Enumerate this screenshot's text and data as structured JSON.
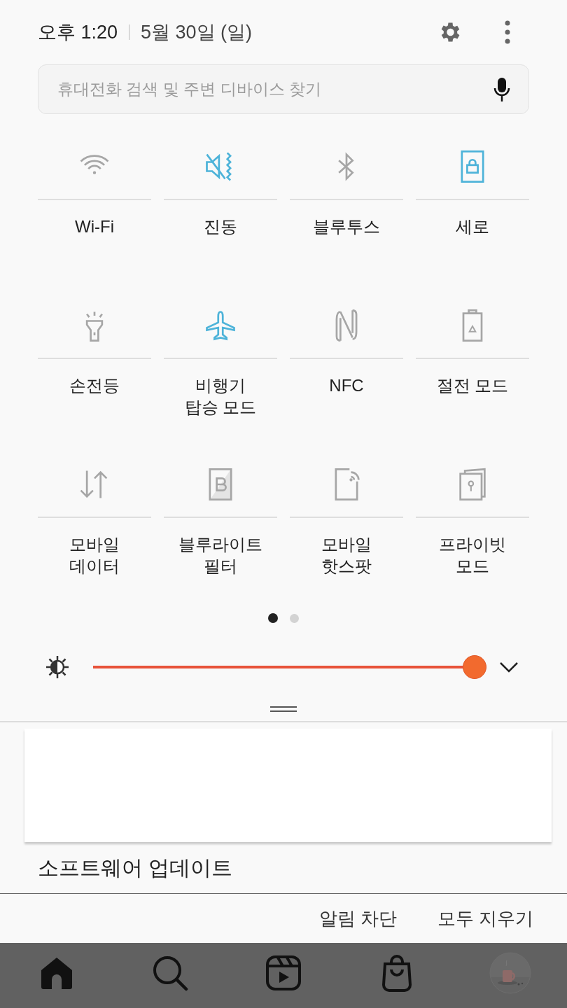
{
  "header": {
    "time": "오후 1:20",
    "date": "5월 30일 (일)"
  },
  "search": {
    "placeholder": "휴대전화 검색 및 주변 디바이스 찾기"
  },
  "tiles": [
    {
      "kind": "wifi",
      "label": "Wi-Fi",
      "on": false
    },
    {
      "kind": "vibrate",
      "label": "진동",
      "on": true
    },
    {
      "kind": "bluetooth",
      "label": "블루투스",
      "on": false
    },
    {
      "kind": "portrait",
      "label": "세로",
      "on": true
    },
    {
      "kind": "flashlight",
      "label": "손전등",
      "on": false
    },
    {
      "kind": "airplane",
      "label": "비행기\n탑승 모드",
      "on": true
    },
    {
      "kind": "nfc",
      "label": "NFC",
      "on": false
    },
    {
      "kind": "battery",
      "label": "절전 모드",
      "on": false
    },
    {
      "kind": "data",
      "label": "모바일\n데이터",
      "on": false
    },
    {
      "kind": "bluelight",
      "label": "블루라이트\n필터",
      "on": false
    },
    {
      "kind": "hotspot",
      "label": "모바일\n핫스팟",
      "on": false
    },
    {
      "kind": "private",
      "label": "프라이빗\n모드",
      "on": false
    }
  ],
  "page_dots": [
    {
      "selected": true
    },
    {
      "selected": false
    }
  ],
  "brightness": {
    "level": 1
  },
  "notification": {
    "title": "소프트웨어 업데이트"
  },
  "actions": [
    "알림 차단",
    "모두 지우기"
  ],
  "nav": [
    {
      "kind": "home"
    },
    {
      "kind": "search"
    },
    {
      "kind": "reels"
    },
    {
      "kind": "shop"
    },
    {
      "kind": "avatar"
    }
  ]
}
